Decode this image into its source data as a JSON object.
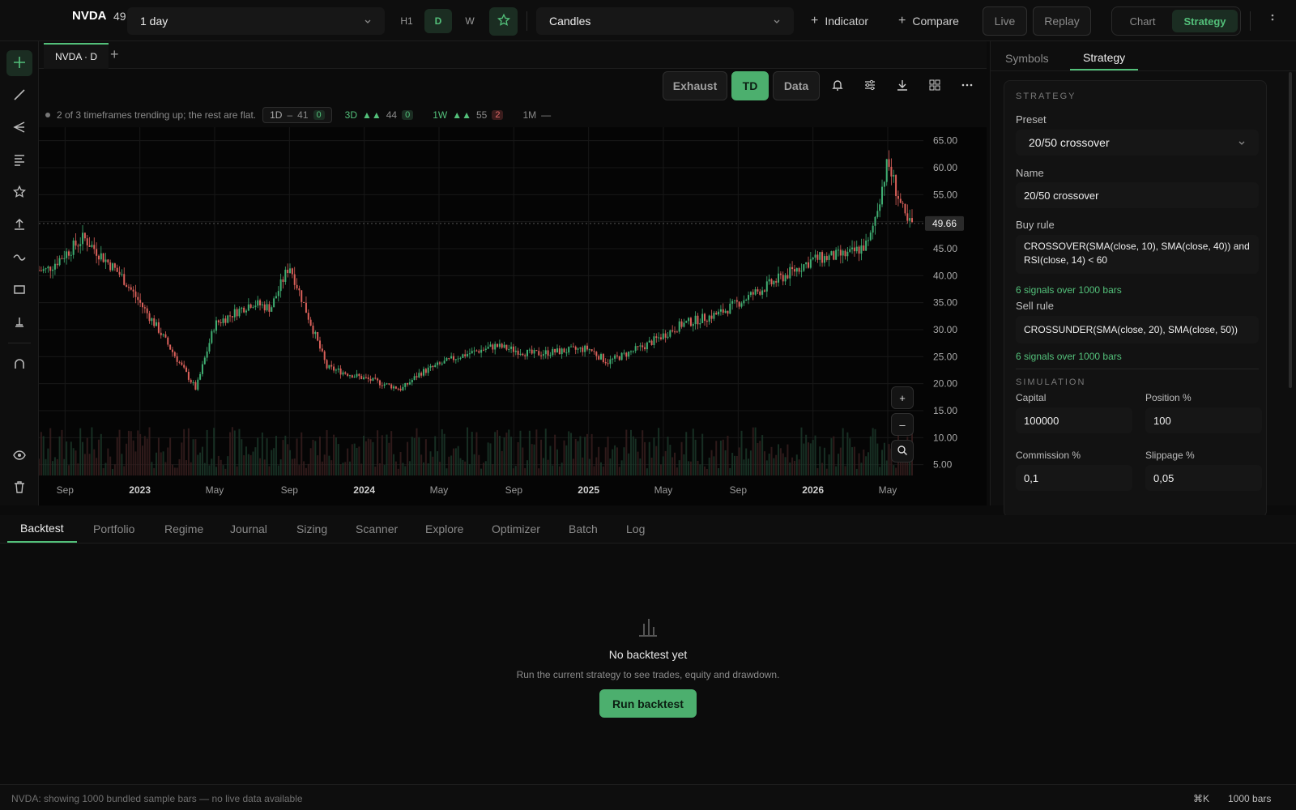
{
  "topbar": {
    "symbol": "NVDA",
    "price_partial": "49",
    "interval": "1 day",
    "timeframes": [
      "H1",
      "D",
      "W"
    ],
    "active_timeframe": "D",
    "chart_type": "Candles",
    "indicator_label": "Indicator",
    "compare_label": "Compare",
    "live_label": "Live",
    "replay_label": "Replay",
    "mode_chart": "Chart",
    "mode_strategy": "Strategy"
  },
  "chart_tabs": {
    "active": "NVDA · D"
  },
  "chart_toolbar": {
    "exhaust": "Exhaust",
    "td": "TD",
    "data": "Data"
  },
  "infobar": {
    "summary": "2 of 3 timeframes trending up; the rest are flat.",
    "tf": [
      {
        "label": "1D",
        "dir": "–",
        "score": "41",
        "count": "0"
      },
      {
        "label": "3D",
        "dir": "▲▲",
        "score": "44",
        "count": "0"
      },
      {
        "label": "1W",
        "dir": "▲▲",
        "score": "55",
        "count": "2"
      },
      {
        "label": "1M",
        "dir": "—",
        "score": "",
        "count": ""
      }
    ]
  },
  "chart_data": {
    "type": "candlestick",
    "title": "",
    "y_ticks": [
      "65.00",
      "60.00",
      "55.00",
      "50.00",
      "45.00",
      "40.00",
      "35.00",
      "30.00",
      "25.00",
      "20.00",
      "15.00",
      "10.00",
      "5.00"
    ],
    "x_ticks": [
      "Sep",
      "2023",
      "May",
      "Sep",
      "2024",
      "May",
      "Sep",
      "2025",
      "May",
      "Sep",
      "2026",
      "May"
    ],
    "ylim": [
      3.0,
      67.5
    ],
    "last_price": "49.66",
    "last_value": 49.66,
    "series": [
      {
        "name": "close",
        "x": [
          "2022-08",
          "2022-10",
          "2022-12",
          "2023-02",
          "2023-04",
          "2023-05",
          "2023-07",
          "2023-08",
          "2023-09",
          "2023-11",
          "2024-01",
          "2024-03",
          "2024-04",
          "2024-06",
          "2024-08",
          "2024-10",
          "2025-01",
          "2025-02",
          "2025-04",
          "2025-06",
          "2025-08",
          "2025-10",
          "2025-12",
          "2026-01",
          "2026-03",
          "2026-04",
          "2026-05",
          "2026-06"
        ],
        "y": [
          41,
          47,
          40,
          30,
          19,
          31,
          35,
          34,
          42,
          23,
          21,
          19,
          22,
          25,
          27,
          25.5,
          26.5,
          24,
          27,
          31,
          33,
          37,
          41,
          43,
          44,
          46,
          61,
          49.66
        ]
      }
    ]
  },
  "zoom_controls": {
    "plus": "+",
    "minus": "–"
  },
  "right_panel": {
    "tabs": [
      "Symbols",
      "Strategy"
    ],
    "active_tab": "Strategy",
    "section_strategy": "STRATEGY",
    "preset_label": "Preset",
    "preset_value": "20/50 crossover",
    "name_label": "Name",
    "name_value": "20/50 crossover",
    "buy_label": "Buy rule",
    "buy_rule": "CROSSOVER(SMA(close, 10), SMA(close, 40)) and RSI(close, 14) < 60",
    "buy_signals": "6 signals over 1000 bars",
    "sell_label": "Sell rule",
    "sell_rule": "CROSSUNDER(SMA(close, 20), SMA(close, 50))",
    "sell_signals": "6 signals over 1000 bars",
    "section_sim": "SIMULATION",
    "capital_label": "Capital",
    "capital_value": "100000",
    "position_label": "Position %",
    "position_value": "100",
    "commission_label": "Commission %",
    "commission_value": "0,1",
    "slippage_label": "Slippage %",
    "slippage_value": "0,05"
  },
  "bottom": {
    "tabs": [
      "Backtest",
      "Portfolio",
      "Regime",
      "Journal",
      "Sizing",
      "Scanner",
      "Explore",
      "Optimizer",
      "Batch",
      "Log"
    ],
    "active_tab": "Backtest",
    "empty_title": "No backtest yet",
    "empty_sub": "Run the current strategy to see trades, equity and drawdown.",
    "run_button": "Run backtest"
  },
  "status": {
    "message": "NVDA: showing 1000 bundled sample bars — no live data available",
    "shortcut": "⌘K",
    "bars": "1000 bars"
  },
  "colors": {
    "accent": "#53c07a",
    "up": "#3fae72",
    "down": "#d9605a",
    "bg": "#0b0b0b"
  }
}
